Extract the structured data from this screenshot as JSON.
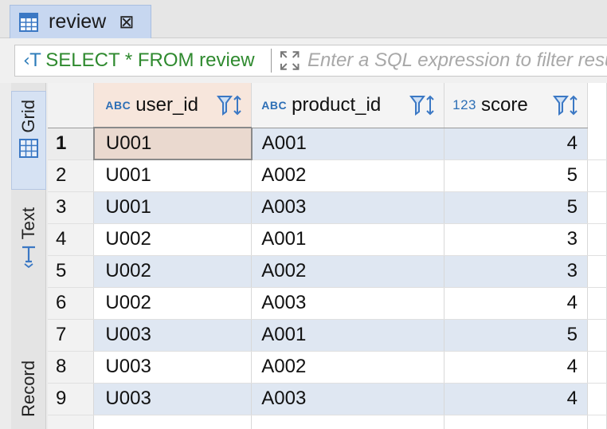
{
  "tab": {
    "title": "review",
    "close": "⊠"
  },
  "filter": {
    "sql": "SELECT * FROM review",
    "placeholder": "Enter a SQL expression to filter results"
  },
  "side_tabs": [
    {
      "label": "Grid",
      "active": true
    },
    {
      "label": "Text",
      "active": false
    },
    {
      "label": "Record",
      "active": false
    }
  ],
  "columns": [
    {
      "type": "ABC",
      "name": "user_id"
    },
    {
      "type": "ABC",
      "name": "product_id"
    },
    {
      "type": "123",
      "name": "score"
    }
  ],
  "rows": [
    {
      "n": "1",
      "user_id": "U001",
      "product_id": "A001",
      "score": "4"
    },
    {
      "n": "2",
      "user_id": "U001",
      "product_id": "A002",
      "score": "5"
    },
    {
      "n": "3",
      "user_id": "U001",
      "product_id": "A003",
      "score": "5"
    },
    {
      "n": "4",
      "user_id": "U002",
      "product_id": "A001",
      "score": "3"
    },
    {
      "n": "5",
      "user_id": "U002",
      "product_id": "A002",
      "score": "3"
    },
    {
      "n": "6",
      "user_id": "U002",
      "product_id": "A003",
      "score": "4"
    },
    {
      "n": "7",
      "user_id": "U003",
      "product_id": "A001",
      "score": "5"
    },
    {
      "n": "8",
      "user_id": "U003",
      "product_id": "A002",
      "score": "4"
    },
    {
      "n": "9",
      "user_id": "U003",
      "product_id": "A003",
      "score": "4"
    }
  ],
  "colors": {
    "accent": "#2d6fb6",
    "sql_green": "#2f8a2f",
    "row_alt": "#dfe7f2",
    "selected": "#ead9cf"
  }
}
